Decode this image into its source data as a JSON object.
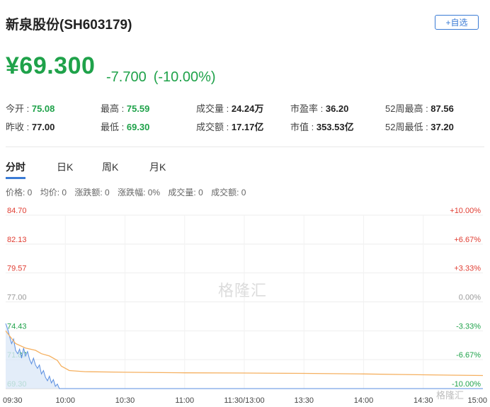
{
  "header": {
    "title": "新泉股份(SH603179)",
    "add_button_label": "+自选"
  },
  "quote": {
    "price": "¥69.300",
    "change": "-7.700",
    "change_pct": "(-10.00%)"
  },
  "stats": {
    "row1": [
      {
        "label": "今开 : ",
        "value": "75.08",
        "color": "green"
      },
      {
        "label": "最高 : ",
        "value": "75.59",
        "color": "green"
      },
      {
        "label": "成交量 : ",
        "value": "24.24万",
        "color": "plain"
      },
      {
        "label": "市盈率 : ",
        "value": "36.20",
        "color": "plain"
      },
      {
        "label": "52周最高 : ",
        "value": "87.56",
        "color": "plain"
      }
    ],
    "row2": [
      {
        "label": "昨收 : ",
        "value": "77.00",
        "color": "plain"
      },
      {
        "label": "最低 : ",
        "value": "69.30",
        "color": "green"
      },
      {
        "label": "成交额 : ",
        "value": "17.17亿",
        "color": "plain"
      },
      {
        "label": "市值 : ",
        "value": "353.53亿",
        "color": "plain"
      },
      {
        "label": "52周最低 : ",
        "value": "37.20",
        "color": "plain"
      }
    ]
  },
  "tabs": [
    "分时",
    "日K",
    "周K",
    "月K"
  ],
  "info_bar": {
    "price": "价格: 0",
    "avg": "均价: 0",
    "change_amt": "涨跌额: 0",
    "change_pct": "涨跌幅: 0%",
    "volume": "成交量: 0",
    "amount": "成交额: 0"
  },
  "watermark": {
    "center": "格隆汇",
    "corner": "格隆汇"
  },
  "colors": {
    "up": "#e03c31",
    "down": "#1fa24a",
    "accent": "#3a7bd5",
    "price_line": "#5a8ee0",
    "avg_line": "#f5b060"
  },
  "chart_data": {
    "type": "line",
    "title": "",
    "y_left_ticks": [
      "84.70",
      "82.13",
      "79.57",
      "77.00",
      "74.43",
      "71.87",
      "69.30"
    ],
    "y_right_ticks": [
      "+10.00%",
      "+6.67%",
      "+3.33%",
      "0.00%",
      "-3.33%",
      "-6.67%",
      "-10.00%"
    ],
    "x_ticks": [
      "09:30",
      "10:00",
      "10:30",
      "11:00",
      "11:30/13:00",
      "13:30",
      "14:00",
      "14:30",
      "15:00"
    ],
    "ylim": [
      69.3,
      84.7
    ],
    "reference": 77.0,
    "grid": true,
    "series": [
      {
        "key": "price",
        "color": "#5a8ee0",
        "fill": "#dce8f8",
        "points": [
          [
            0,
            75.08
          ],
          [
            1,
            74.6
          ],
          [
            2,
            73.9
          ],
          [
            3,
            73.3
          ],
          [
            4,
            73.7
          ],
          [
            5,
            72.7
          ],
          [
            6,
            72.4
          ],
          [
            7,
            72.8
          ],
          [
            8,
            72.0
          ],
          [
            9,
            72.9
          ],
          [
            10,
            72.2
          ],
          [
            11,
            72.6
          ],
          [
            12,
            71.9
          ],
          [
            13,
            71.5
          ],
          [
            14,
            72.0
          ],
          [
            15,
            71.4
          ],
          [
            16,
            71.1
          ],
          [
            17,
            71.4
          ],
          [
            18,
            70.6
          ],
          [
            19,
            70.9
          ],
          [
            20,
            70.3
          ],
          [
            21,
            70.0
          ],
          [
            22,
            70.4
          ],
          [
            23,
            69.8
          ],
          [
            24,
            70.1
          ],
          [
            25,
            69.5
          ],
          [
            26,
            69.7
          ],
          [
            27,
            69.3
          ],
          [
            30,
            69.3
          ],
          [
            40,
            69.3
          ],
          [
            60,
            69.3
          ],
          [
            90,
            69.3
          ],
          [
            120,
            69.3
          ],
          [
            150,
            69.3
          ],
          [
            180,
            69.3
          ],
          [
            210,
            69.3
          ],
          [
            240,
            69.3
          ]
        ]
      },
      {
        "key": "avg",
        "color": "#f5b060",
        "points": [
          [
            0,
            74.43
          ],
          [
            5,
            73.3
          ],
          [
            10,
            72.9
          ],
          [
            15,
            72.7
          ],
          [
            18,
            72.4
          ],
          [
            22,
            72.2
          ],
          [
            26,
            71.8
          ],
          [
            28,
            71.3
          ],
          [
            32,
            70.9
          ],
          [
            40,
            70.8
          ],
          [
            60,
            70.75
          ],
          [
            90,
            70.7
          ],
          [
            120,
            70.68
          ],
          [
            150,
            70.65
          ],
          [
            180,
            70.6
          ],
          [
            200,
            70.55
          ],
          [
            220,
            70.5
          ],
          [
            240,
            70.46
          ]
        ]
      }
    ]
  }
}
